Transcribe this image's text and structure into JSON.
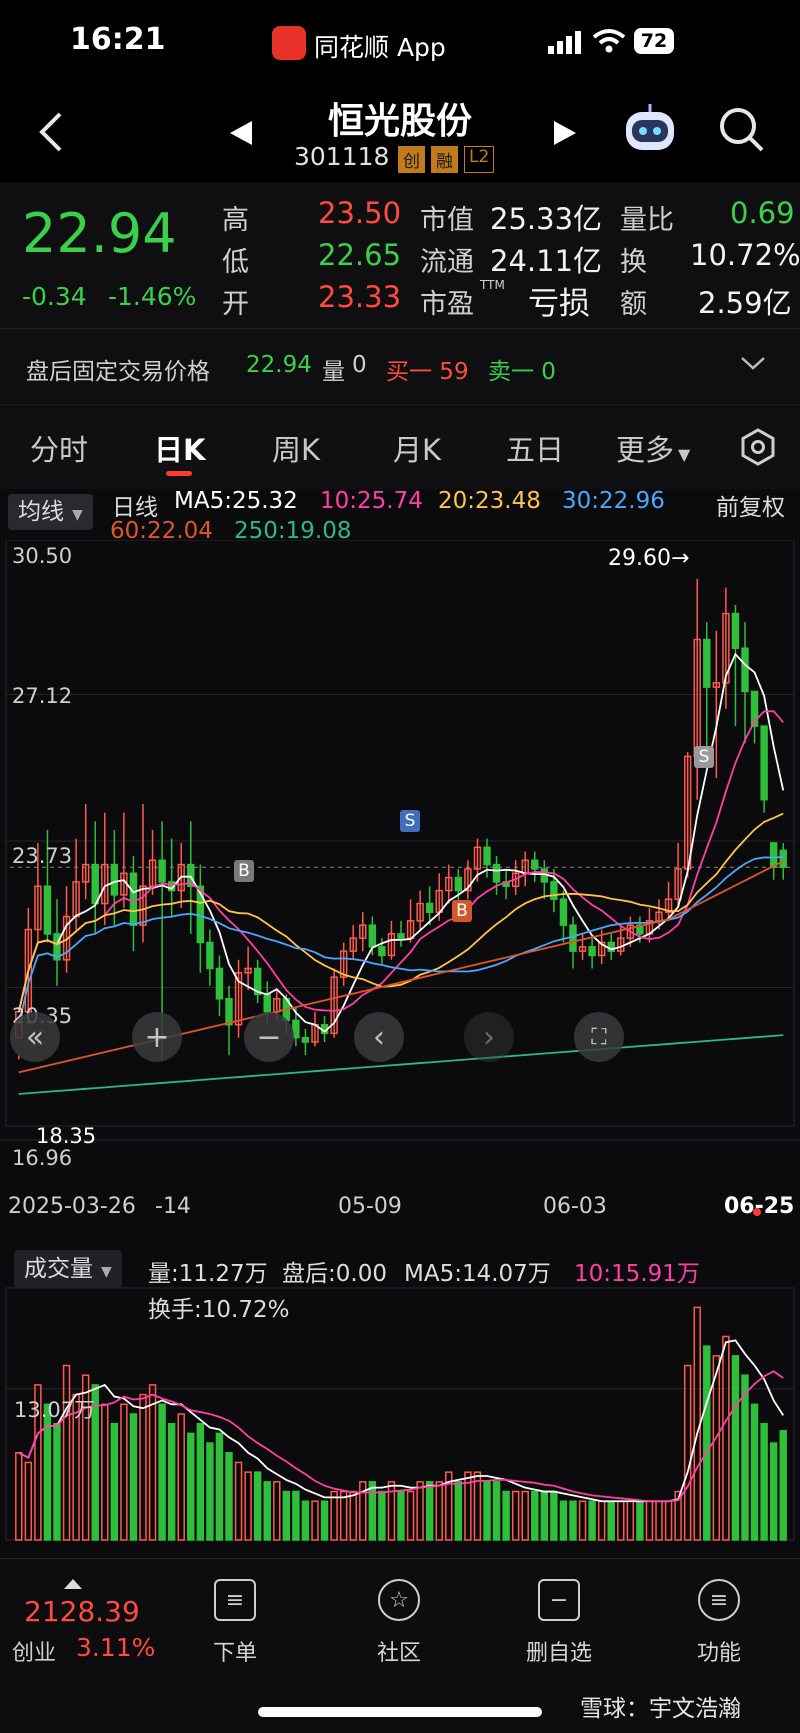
{
  "status": {
    "time": "16:21",
    "app": "同花顺 App",
    "battery": "72"
  },
  "nav": {
    "name": "恒光股份",
    "code": "301118",
    "badges": [
      "创",
      "融",
      "L2"
    ]
  },
  "quote": {
    "price": "22.94",
    "change": "-0.34",
    "change_pct": "-1.46%",
    "high_label": "高",
    "high": "23.50",
    "low_label": "低",
    "low": "22.65",
    "open_label": "开",
    "open": "23.33",
    "mcap_label": "市值",
    "mcap": "25.33亿",
    "float_label": "流通",
    "float": "24.11亿",
    "pe_label": "市盈",
    "pe_sup": "TTM",
    "pe": "亏损",
    "vr_label": "量比",
    "vr": "0.69",
    "turn_label": "换",
    "turn": "10.72%",
    "amt_label": "额",
    "amt": "2.59亿",
    "after_label": "盘后固定交易价格",
    "after_price": "22.94",
    "after_vol_label": "量",
    "after_vol": "0",
    "buy1": "买一 59",
    "sell1": "卖一 0"
  },
  "tabs": [
    "分时",
    "日K",
    "周K",
    "月K",
    "五日",
    "更多"
  ],
  "kline": {
    "ma_selector": "均线",
    "ma_title": "日线",
    "ma5": "MA5:25.32",
    "ma10": "10:25.74",
    "ma20": "20:23.48",
    "ma30": "30:22.96",
    "ma60": "60:22.04",
    "ma250": "250:19.08",
    "adjust": "前复权",
    "y_labels": [
      "30.50",
      "27.12",
      "23.73",
      "20.35",
      "16.96"
    ],
    "max_label": "29.60→",
    "min_label": "18.35",
    "x_labels": [
      "2025-03-26",
      "-14",
      "05-09",
      "06-03",
      "06-25"
    ],
    "marks": [
      "S",
      "B",
      "B",
      "S"
    ],
    "colors": {
      "ma5": "#ffffff",
      "ma10": "#ff3fa5",
      "ma20": "#ffc34a",
      "ma30": "#4aa8ff",
      "ma60": "#e0552a",
      "ma250": "#2fb887",
      "up": "#ff5a4a",
      "down": "#2fbf3a"
    }
  },
  "volume": {
    "selector": "成交量",
    "vol": "量:11.27万",
    "after": "盘后:0.00",
    "ma5": "MA5:14.07万",
    "ma10": "10:15.91万",
    "turnover": "换手:10.72%",
    "y_label": "13.07万"
  },
  "chart_data": {
    "type": "candlestick",
    "ylim": [
      16.96,
      30.5
    ],
    "candles": [
      [
        19.0,
        19.6,
        18.6,
        18.5
      ],
      [
        19.6,
        21.5,
        19.3,
        22.0
      ],
      [
        21.5,
        22.5,
        21.2,
        23.5
      ],
      [
        22.5,
        21.4,
        21.2,
        23.8
      ],
      [
        21.4,
        20.8,
        20.2,
        22.2
      ],
      [
        20.8,
        21.8,
        20.5,
        22.5
      ],
      [
        21.8,
        22.6,
        21.5,
        23.6
      ],
      [
        22.6,
        23.0,
        22.2,
        24.4
      ],
      [
        23.0,
        22.1,
        21.4,
        24.0
      ],
      [
        22.1,
        23.0,
        21.6,
        24.2
      ],
      [
        23.0,
        22.3,
        21.6,
        23.8
      ],
      [
        22.3,
        22.8,
        22.0,
        24.2
      ],
      [
        22.8,
        21.6,
        21.0,
        23.2
      ],
      [
        21.6,
        22.5,
        21.2,
        24.4
      ],
      [
        22.5,
        23.1,
        22.3,
        23.8
      ],
      [
        23.1,
        22.6,
        18.5,
        24.0
      ],
      [
        22.6,
        22.4,
        21.8,
        23.6
      ],
      [
        22.4,
        23.0,
        22.0,
        23.5
      ],
      [
        23.0,
        22.5,
        21.4,
        24.0
      ],
      [
        22.5,
        21.2,
        20.5,
        23.0
      ],
      [
        21.2,
        20.6,
        20.2,
        21.5
      ],
      [
        20.6,
        19.9,
        19.5,
        20.9
      ],
      [
        19.9,
        19.3,
        18.6,
        20.2
      ],
      [
        19.3,
        20.5,
        19.0,
        20.8
      ],
      [
        20.5,
        20.6,
        20.1,
        21.1
      ],
      [
        20.6,
        20.0,
        19.8,
        20.8
      ],
      [
        20.0,
        19.6,
        19.3,
        20.3
      ],
      [
        19.6,
        19.9,
        19.4,
        20.1
      ],
      [
        19.9,
        19.4,
        19.1,
        20.0
      ],
      [
        19.4,
        19.0,
        18.8,
        19.7
      ],
      [
        19.0,
        18.9,
        18.6,
        19.2
      ],
      [
        18.9,
        19.3,
        18.8,
        19.6
      ],
      [
        19.3,
        19.1,
        18.9,
        19.5
      ],
      [
        19.1,
        20.4,
        19.0,
        20.6
      ],
      [
        20.4,
        21.0,
        20.2,
        21.2
      ],
      [
        21.0,
        21.3,
        20.8,
        21.6
      ],
      [
        21.3,
        21.6,
        21.0,
        21.9
      ],
      [
        21.6,
        21.1,
        20.9,
        21.8
      ],
      [
        21.1,
        20.9,
        20.7,
        21.3
      ],
      [
        20.9,
        21.4,
        20.8,
        21.7
      ],
      [
        21.4,
        21.3,
        21.1,
        21.7
      ],
      [
        21.3,
        21.7,
        21.2,
        22.2
      ],
      [
        21.7,
        22.1,
        21.5,
        22.4
      ],
      [
        22.1,
        21.9,
        21.6,
        22.5
      ],
      [
        21.9,
        22.4,
        21.7,
        22.8
      ],
      [
        22.4,
        22.7,
        22.1,
        23.0
      ],
      [
        22.7,
        22.4,
        22.1,
        22.9
      ],
      [
        22.4,
        22.9,
        22.2,
        23.1
      ],
      [
        22.9,
        23.4,
        22.6,
        23.6
      ],
      [
        23.4,
        23.0,
        22.7,
        23.6
      ],
      [
        23.0,
        22.6,
        22.3,
        23.2
      ],
      [
        22.6,
        22.5,
        22.2,
        22.9
      ],
      [
        22.5,
        22.8,
        22.3,
        23.1
      ],
      [
        22.8,
        23.1,
        22.5,
        23.3
      ],
      [
        23.1,
        22.9,
        22.6,
        23.3
      ],
      [
        22.9,
        22.6,
        22.2,
        23.1
      ],
      [
        22.6,
        22.2,
        21.9,
        22.9
      ],
      [
        22.2,
        21.6,
        21.2,
        22.4
      ],
      [
        21.6,
        21.0,
        20.6,
        21.8
      ],
      [
        21.0,
        21.1,
        20.8,
        21.4
      ],
      [
        21.1,
        20.9,
        20.6,
        21.3
      ],
      [
        20.9,
        21.2,
        20.7,
        21.5
      ],
      [
        21.2,
        21.0,
        20.8,
        21.4
      ],
      [
        21.0,
        21.3,
        20.9,
        21.6
      ],
      [
        21.3,
        21.6,
        21.1,
        21.8
      ],
      [
        21.6,
        21.4,
        21.2,
        21.8
      ],
      [
        21.4,
        21.7,
        21.2,
        22.0
      ],
      [
        21.7,
        21.9,
        21.5,
        22.2
      ],
      [
        21.9,
        22.2,
        21.7,
        22.6
      ],
      [
        22.2,
        22.9,
        22.0,
        23.5
      ],
      [
        22.9,
        25.5,
        22.7,
        25.6
      ],
      [
        25.5,
        28.2,
        24.5,
        29.6
      ],
      [
        28.2,
        27.1,
        25.6,
        28.6
      ],
      [
        27.1,
        27.2,
        25.0,
        28.4
      ],
      [
        27.2,
        28.8,
        26.6,
        29.4
      ],
      [
        28.8,
        28.0,
        26.2,
        29.0
      ],
      [
        28.0,
        27.0,
        25.8,
        28.6
      ],
      [
        27.0,
        26.2,
        25.8,
        26.8
      ],
      [
        26.2,
        24.5,
        24.2,
        25.0
      ],
      [
        23.5,
        22.94,
        22.65,
        23.5
      ],
      [
        23.33,
        22.94,
        22.65,
        23.5
      ]
    ],
    "volume_series": [
      9,
      8,
      16,
      14,
      12,
      18,
      15,
      17,
      16,
      14,
      12,
      14,
      13,
      15,
      16,
      14,
      12,
      13,
      11,
      12,
      10,
      11,
      9,
      8,
      7,
      7,
      6,
      6,
      5,
      5,
      4,
      4,
      4,
      5,
      5,
      5,
      6,
      6,
      5,
      6,
      5,
      5,
      6,
      6,
      6,
      7,
      6,
      7,
      7,
      6,
      6,
      5,
      5,
      5,
      5,
      5,
      5,
      4,
      4,
      4,
      4,
      4,
      4,
      4,
      4,
      4,
      4,
      4,
      4,
      5,
      18,
      24,
      20,
      19,
      21,
      19,
      17,
      14,
      12,
      10,
      11.27
    ]
  },
  "toolbar": {
    "index_value": "2128.39",
    "index_name": "创业",
    "index_pct": "3.11%",
    "items": [
      "下单",
      "社区",
      "删自选",
      "功能"
    ],
    "watermark": "雪球：宇文浩瀚"
  }
}
